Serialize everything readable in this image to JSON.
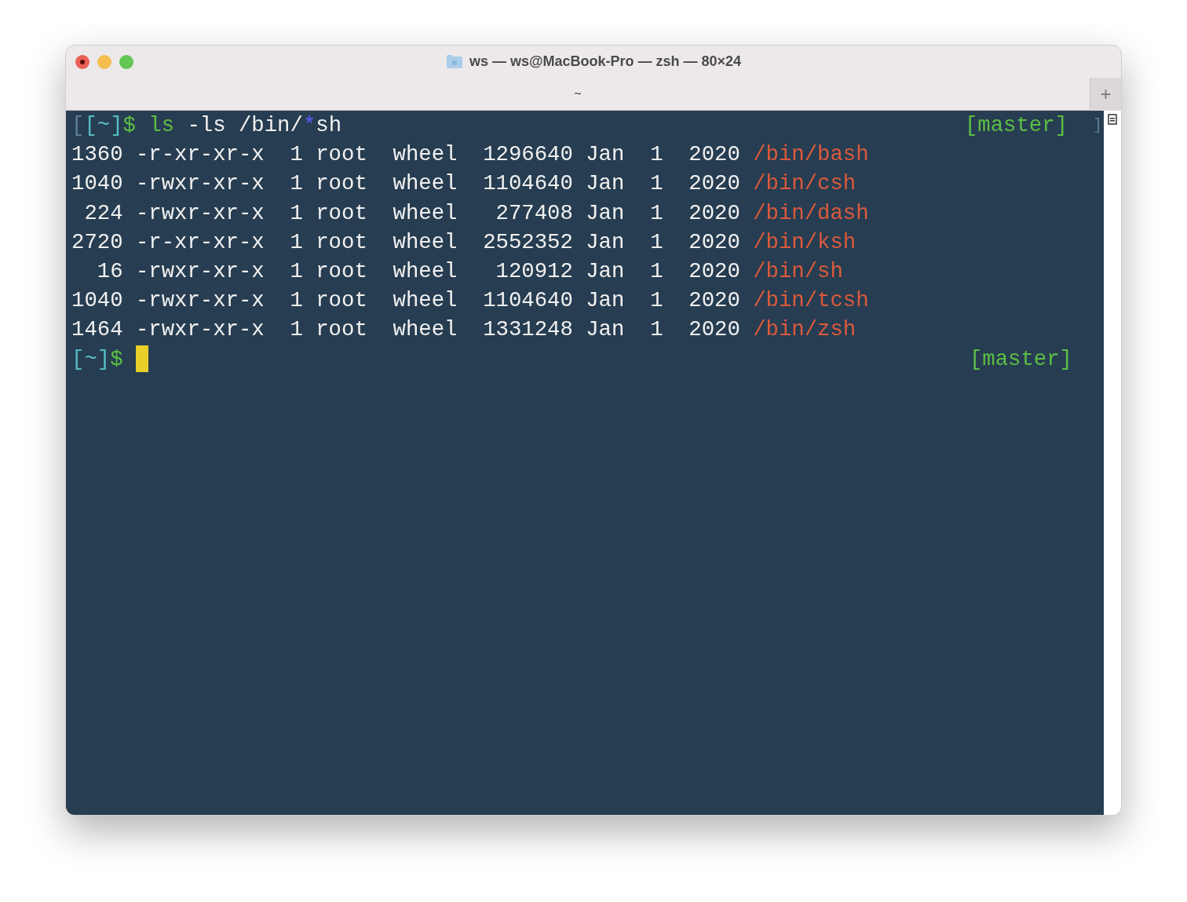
{
  "window": {
    "title": "ws — ws@MacBook-Pro — zsh — 80×24"
  },
  "tabs": [
    {
      "label": "~",
      "selected": true
    }
  ],
  "new_tab_button": "+",
  "terminal": {
    "lines": [
      {
        "segments": [
          {
            "kind": "stray",
            "text": "["
          },
          {
            "kind": "bracket",
            "text": "[~]"
          },
          {
            "kind": "dollar",
            "text": "$ "
          },
          {
            "kind": "command",
            "text": "ls"
          },
          {
            "kind": "text",
            "text": " -ls /bin/"
          },
          {
            "kind": "glob",
            "text": "*"
          },
          {
            "kind": "text",
            "text": "sh"
          }
        ],
        "right": "[master]",
        "right_stray": "]"
      },
      {
        "segments": [
          {
            "kind": "text",
            "text": "1360 -r-xr-xr-x  1 root  wheel  1296640 Jan  1  2020 "
          },
          {
            "kind": "path",
            "text": "/bin/bash"
          }
        ]
      },
      {
        "segments": [
          {
            "kind": "text",
            "text": "1040 -rwxr-xr-x  1 root  wheel  1104640 Jan  1  2020 "
          },
          {
            "kind": "path",
            "text": "/bin/csh"
          }
        ]
      },
      {
        "segments": [
          {
            "kind": "text",
            "text": " 224 -rwxr-xr-x  1 root  wheel   277408 Jan  1  2020 "
          },
          {
            "kind": "path",
            "text": "/bin/dash"
          }
        ]
      },
      {
        "segments": [
          {
            "kind": "text",
            "text": "2720 -r-xr-xr-x  1 root  wheel  2552352 Jan  1  2020 "
          },
          {
            "kind": "path",
            "text": "/bin/ksh"
          }
        ]
      },
      {
        "segments": [
          {
            "kind": "text",
            "text": "  16 -rwxr-xr-x  1 root  wheel   120912 Jan  1  2020 "
          },
          {
            "kind": "path",
            "text": "/bin/sh"
          }
        ]
      },
      {
        "segments": [
          {
            "kind": "text",
            "text": "1040 -rwxr-xr-x  1 root  wheel  1104640 Jan  1  2020 "
          },
          {
            "kind": "path",
            "text": "/bin/tcsh"
          }
        ]
      },
      {
        "segments": [
          {
            "kind": "text",
            "text": "1464 -rwxr-xr-x  1 root  wheel  1331248 Jan  1  2020 "
          },
          {
            "kind": "path",
            "text": "/bin/zsh"
          }
        ]
      },
      {
        "segments": [
          {
            "kind": "bracket",
            "text": "[~]"
          },
          {
            "kind": "dollar",
            "text": "$ "
          }
        ],
        "right": "[master]",
        "cursor": true
      }
    ]
  }
}
